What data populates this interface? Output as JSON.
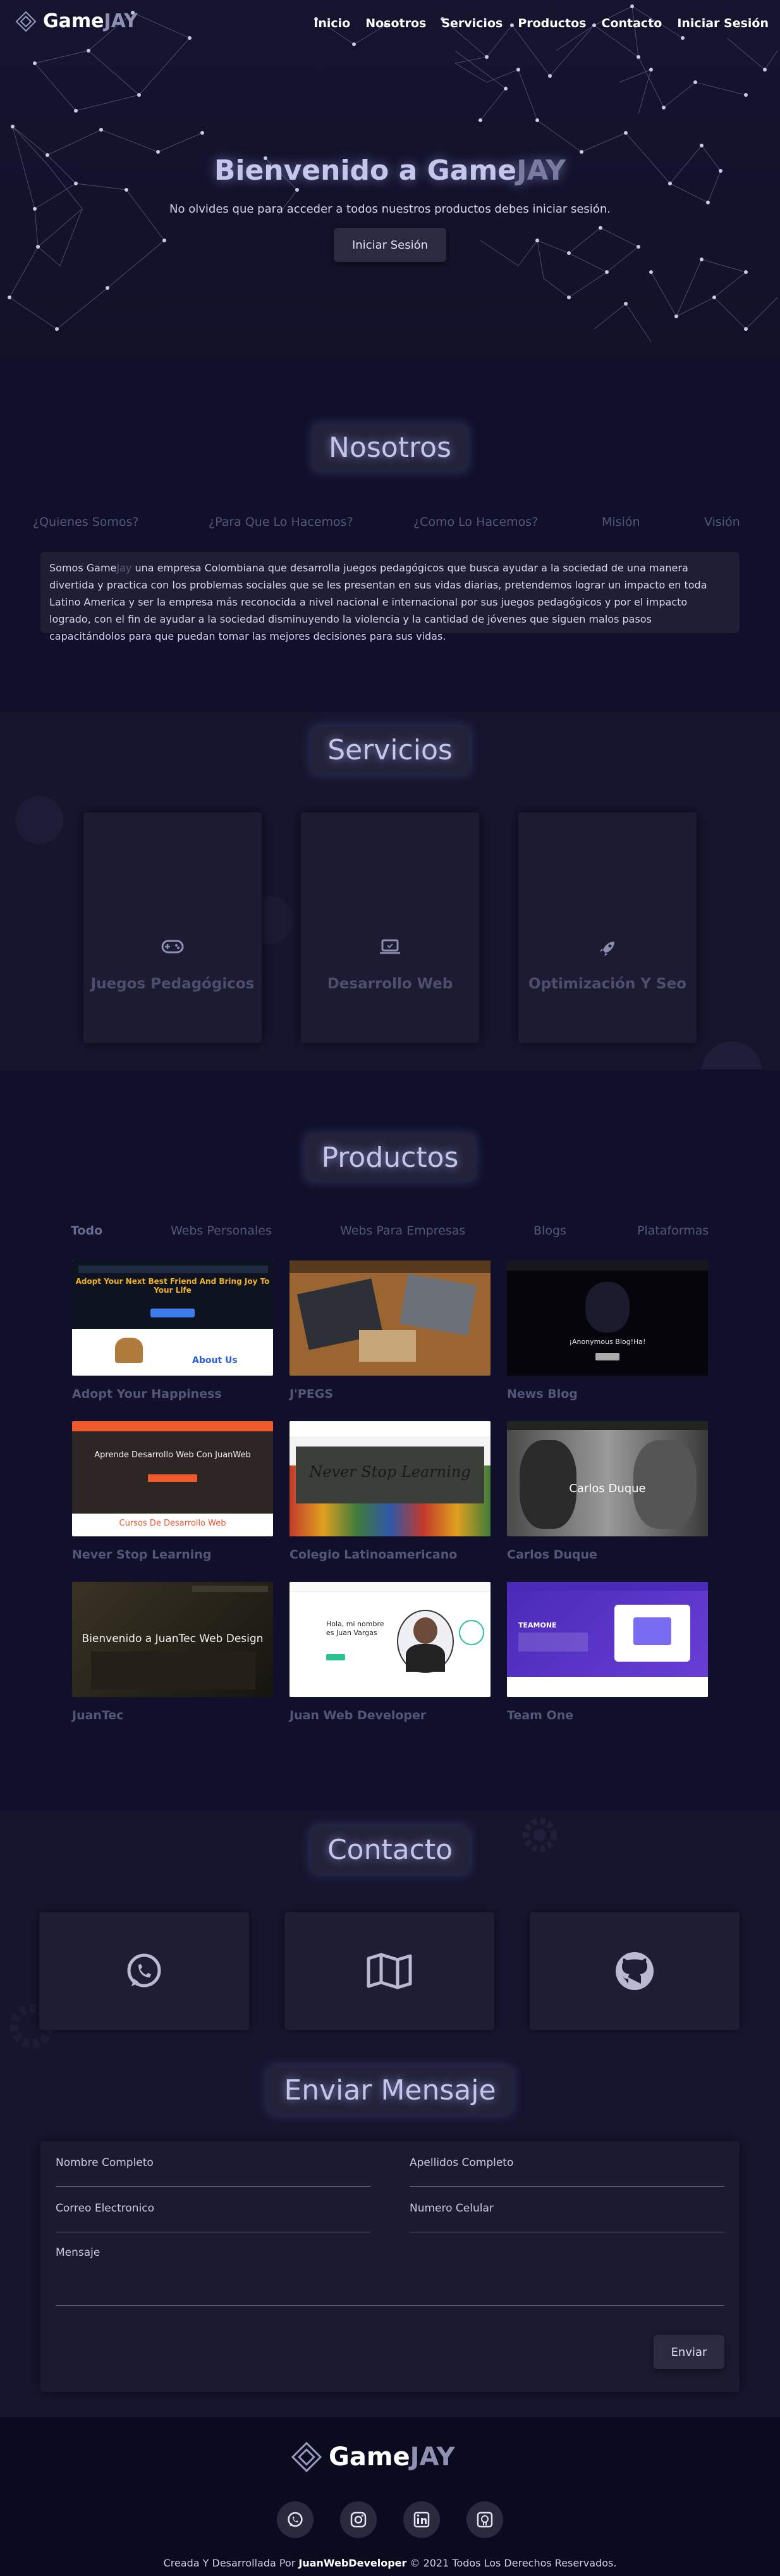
{
  "brand": {
    "name_main": "Game",
    "name_accent": "JAY"
  },
  "nav": {
    "items": [
      {
        "label": "Inicio"
      },
      {
        "label": "Nosotros"
      },
      {
        "label": "Servicios"
      },
      {
        "label": "Productos"
      },
      {
        "label": "Contacto"
      },
      {
        "label": "Iniciar Sesión"
      }
    ]
  },
  "hero": {
    "title_main": "Bienvenido a Game",
    "title_accent": "JAY",
    "subtitle": "No olvides que para acceder a todos nuestros productos debes iniciar sesión.",
    "button": "Iniciar Sesión"
  },
  "about": {
    "title": "Nosotros",
    "tabs": [
      "¿Quienes Somos?",
      "¿Para Que Lo Hacemos?",
      "¿Como Lo Hacemos?",
      "Misión",
      "Visión"
    ],
    "text_prefix": "Somos Game",
    "text_accent": "Jay",
    "text_body": " una empresa Colombiana que desarrolla juegos pedagógicos que busca ayudar a la sociedad de una manera divertida y practica con los problemas sociales que se les presentan en sus vidas diarias, pretendemos lograr un impacto en toda Latino America y ser la empresa más reconocida a nivel nacional e internacional por sus juegos pedagógicos y por el impacto logrado, con el fin de ayudar a la sociedad disminuyendo la violencia y la cantidad de jóvenes que siguen malos pasos capacitándolos para que puedan tomar las mejores decisiones para sus vidas."
  },
  "services": {
    "title": "Servicios",
    "cards": [
      {
        "label": "Juegos Pedagógicos",
        "icon": "gamepad-icon"
      },
      {
        "label": "Desarrollo Web",
        "icon": "laptop-icon"
      },
      {
        "label": "Optimización Y Seo",
        "icon": "rocket-icon"
      }
    ]
  },
  "products": {
    "title": "Productos",
    "filters": [
      "Todo",
      "Webs Personales",
      "Webs Para Empresas",
      "Blogs",
      "Plataformas"
    ],
    "items": [
      {
        "name": "Adopt Your Happiness",
        "thumb_text": "Adopt Your Next Best Friend And Bring Joy To Your Life",
        "thumb_sub": "About Us"
      },
      {
        "name": "J'PEGS",
        "thumb_text": "",
        "thumb_sub": ""
      },
      {
        "name": "News Blog",
        "thumb_text": "¡Anonymous Blog!Ha!",
        "thumb_sub": ""
      },
      {
        "name": "Never Stop Learning",
        "thumb_text": "Aprende Desarrollo Web Con JuanWeb",
        "thumb_sub": "Cursos De Desarrollo Web"
      },
      {
        "name": "Colegio Latinoamericano",
        "thumb_text": "Never Stop Learning",
        "thumb_sub": ""
      },
      {
        "name": "Carlos Duque",
        "thumb_text": "Carlos Duque",
        "thumb_sub": ""
      },
      {
        "name": "JuanTec",
        "thumb_text": "Bienvenido a JuanTec Web Design",
        "thumb_sub": ""
      },
      {
        "name": "Juan Web Developer",
        "thumb_text": "Hola, mi nombre es Juan Vargas",
        "thumb_sub": ""
      },
      {
        "name": "Team One",
        "thumb_text": "TEAMONE",
        "thumb_sub": ""
      }
    ]
  },
  "contact": {
    "title": "Contacto",
    "cards": [
      {
        "icon": "whatsapp-icon"
      },
      {
        "icon": "map-icon"
      },
      {
        "icon": "github-icon"
      }
    ]
  },
  "message_form": {
    "title": "Enviar Mensaje",
    "fields": {
      "name": "Nombre Completo",
      "lastname": "Apellidos Completo",
      "email": "Correo Electronico",
      "phone": "Numero Celular",
      "message": "Mensaje"
    },
    "submit": "Enviar"
  },
  "footer": {
    "socials": [
      {
        "icon": "whatsapp-icon"
      },
      {
        "icon": "instagram-icon"
      },
      {
        "icon": "linkedin-icon"
      },
      {
        "icon": "github-icon"
      }
    ],
    "copyright_prefix": "Creada Y Desarrollada Por ",
    "copyright_author": "JuanWebDeveloper",
    "copyright_suffix": " © 2021 Todos Los Derechos Reservados."
  },
  "colors": {
    "background": "#10102a",
    "card": "#1b1b31",
    "footer": "#0b0b1f",
    "muted_text": "#55557a"
  }
}
